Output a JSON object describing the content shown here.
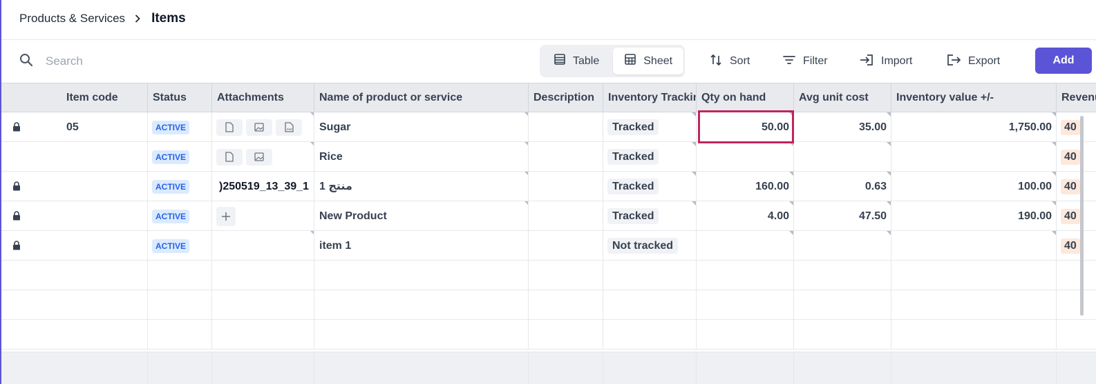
{
  "breadcrumb": {
    "parent": "Products & Services",
    "current": "Items"
  },
  "toolbar": {
    "search_placeholder": "Search",
    "view_table": "Table",
    "view_sheet": "Sheet",
    "active_view": "Sheet",
    "sort": "Sort",
    "filter": "Filter",
    "import": "Import",
    "export": "Export",
    "add": "Add"
  },
  "colors": {
    "accent": "#5b54d6",
    "selection": "#c0245e",
    "active_badge_bg": "#dbeafe",
    "active_badge_text": "#2563eb"
  },
  "columns": [
    "Item code",
    "Status",
    "Attachments",
    "Name of product or service",
    "Description",
    "Inventory Tracking",
    "Qty on hand",
    "Avg unit cost",
    "Inventory value +/-",
    "Revenue"
  ],
  "rows": [
    {
      "locked": true,
      "item_code": "05",
      "status": "ACTIVE",
      "attachments": [
        "file-icon",
        "image-icon",
        "pdf-icon"
      ],
      "attachment_text": "",
      "name": "Sugar",
      "description": "",
      "tracking": "Tracked",
      "qty": "50.00",
      "avg_cost": "35.00",
      "inv_value": "1,750.00",
      "revenue": "40"
    },
    {
      "locked": false,
      "item_code": "",
      "status": "ACTIVE",
      "attachments": [
        "file-icon",
        "image-icon"
      ],
      "attachment_text": "",
      "name": "Rice",
      "description": "",
      "tracking": "Tracked",
      "qty": "",
      "avg_cost": "",
      "inv_value": "",
      "revenue": "40"
    },
    {
      "locked": true,
      "item_code": "",
      "status": "ACTIVE",
      "attachments": [],
      "attachment_text": ")250519_13_39_1",
      "name": "منتج 1",
      "description": "",
      "tracking": "Tracked",
      "qty": "160.00",
      "avg_cost": "0.63",
      "inv_value": "100.00",
      "revenue": "40"
    },
    {
      "locked": true,
      "item_code": "",
      "status": "ACTIVE",
      "attachments": [
        "plus-icon"
      ],
      "attachment_text": "",
      "name": "New Product",
      "description": "",
      "tracking": "Tracked",
      "qty": "4.00",
      "avg_cost": "47.50",
      "inv_value": "190.00",
      "revenue": "40"
    },
    {
      "locked": true,
      "item_code": "",
      "status": "ACTIVE",
      "attachments": [],
      "attachment_text": "",
      "name": "item 1",
      "description": "",
      "tracking": "Not tracked",
      "qty": "",
      "avg_cost": "",
      "inv_value": "",
      "revenue": "40"
    }
  ]
}
